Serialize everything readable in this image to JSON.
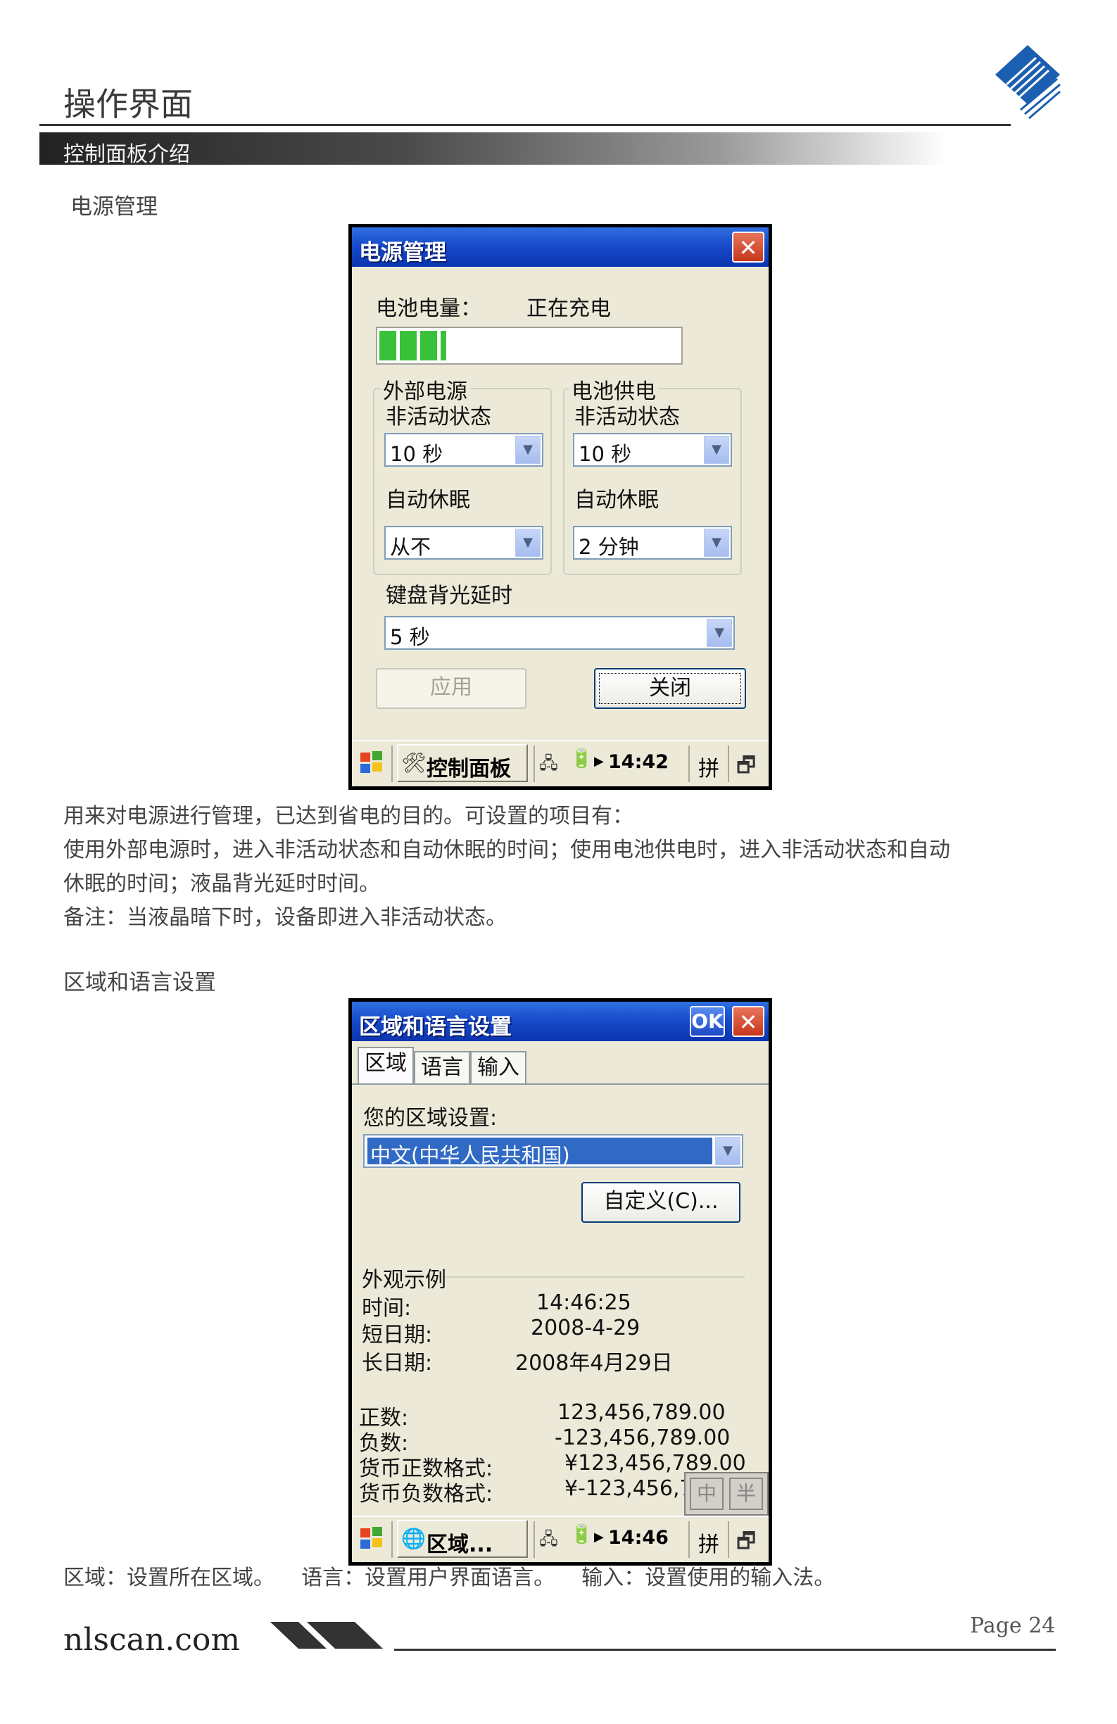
{
  "header": {
    "title": "操作界面",
    "section": "控制面板介绍"
  },
  "power": {
    "heading": "电源管理",
    "window_title": "电源管理",
    "battery_label": "电池电量：",
    "battery_status": "正在充电",
    "battery_fill": 0.22,
    "ext_group": "外部电源",
    "bat_group": "电池供电",
    "inactive_label": "非活动状态",
    "sleep_label": "自动休眠",
    "ext_inactive": "10 秒",
    "ext_sleep": "从不",
    "bat_inactive": "10 秒",
    "bat_sleep": "2 分钟",
    "backlight_label": "键盘背光延时",
    "backlight_value": "5 秒",
    "apply_label": "应用",
    "close_label": "关闭",
    "close_x": "✕",
    "taskbar_item": "控制面板",
    "time": "14:42",
    "ime": "拼"
  },
  "power_desc": [
    "用来对电源进行管理，已达到省电的目的。可设置的项目有：",
    "使用外部电源时，进入非活动状态和自动休眠的时间；使用电池供电时，进入非活动状态和自动",
    "休眠的时间；液晶背光延时时间。",
    "备注：当液晶暗下时，设备即进入非活动状态。"
  ],
  "region": {
    "heading": "区域和语言设置",
    "window_title": "区域和语言设置",
    "ok_label": "OK",
    "close_x": "✕",
    "tabs": [
      "区域",
      "语言",
      "输入"
    ],
    "setting_label": "您的区域设置:",
    "setting_value": "中文(中华人民共和国)",
    "customize_label": "自定义(C)...",
    "sample_label": "外观示例",
    "rows": [
      {
        "label": "时间:",
        "value": "14:46:25"
      },
      {
        "label": "短日期:",
        "value": "2008-4-29"
      },
      {
        "label": "长日期:",
        "value": "2008年4月29日"
      }
    ],
    "num_rows": [
      {
        "label": "正数:",
        "value": "123,456,789.00"
      },
      {
        "label": "负数:",
        "value": "-123,456,789.00"
      },
      {
        "label": "货币正数格式:",
        "value": "¥123,456,789.00"
      },
      {
        "label": "货币负数格式:",
        "value": "¥-123,456,7"
      }
    ],
    "ime_mode1": "中",
    "ime_mode2": "半",
    "taskbar_item": "区域...",
    "time": "14:46",
    "ime": "拼"
  },
  "region_desc": "区域：设置所在区域。    语言：设置用户界面语言。    输入：设置使用的输入法。",
  "footer": {
    "site": "nlscan.com",
    "page": "Page 24"
  }
}
